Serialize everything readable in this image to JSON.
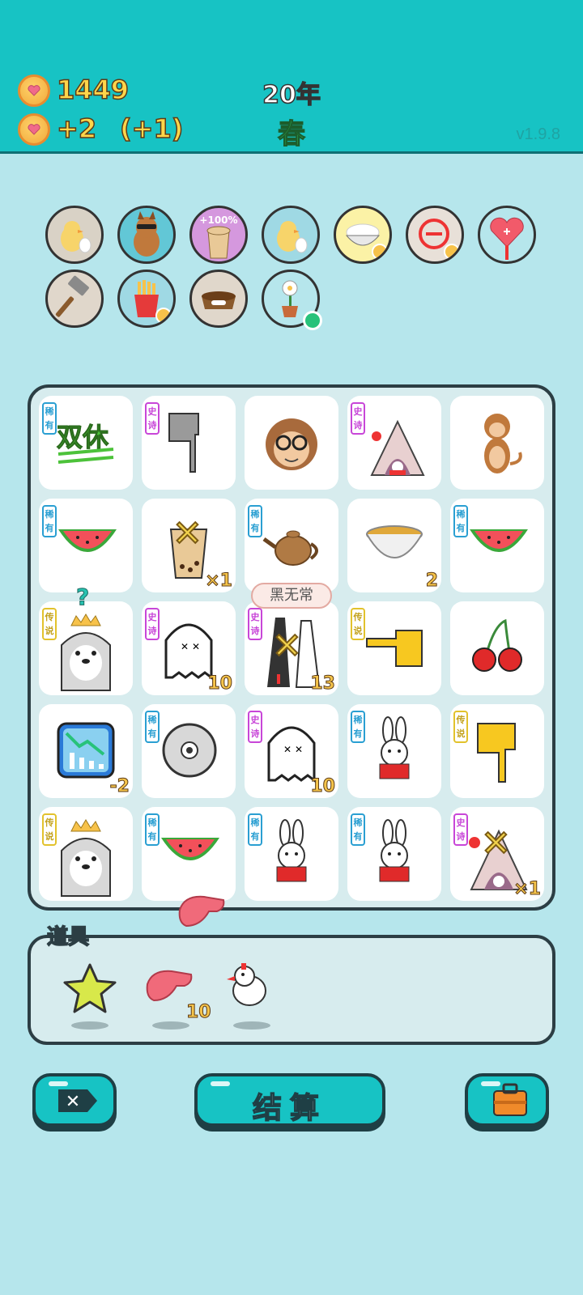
{
  "header": {
    "coins": "1449",
    "income": "+2",
    "bonus": "(+1)",
    "year": "20年",
    "season": "春",
    "version": "v1.9.8"
  },
  "buffs": {
    "items": [
      {
        "icon": "chick-egg-icon"
      },
      {
        "icon": "dog-sunglasses-icon"
      },
      {
        "icon": "bubble-tea-icon",
        "label": "+100%"
      },
      {
        "icon": "chick-egg-icon"
      },
      {
        "icon": "rice-bowl-icon"
      },
      {
        "icon": "minus-circle-icon"
      },
      {
        "icon": "heart-sign-icon"
      },
      {
        "icon": "hammer-icon"
      },
      {
        "icon": "fries-icon"
      },
      {
        "icon": "pet-food-icon"
      },
      {
        "icon": "flower-pot-icon"
      }
    ]
  },
  "board": {
    "rows": [
      [
        {
          "icon": "double-rest-icon",
          "tag": "稀有",
          "rarity": "rare",
          "text": "双休"
        },
        {
          "icon": "pointing-hand-gray-icon",
          "tag": "史诗",
          "rarity": "epic"
        },
        {
          "icon": "old-monkey-glasses-icon"
        },
        {
          "icon": "rabbit-tent-icon",
          "tag": "史诗",
          "rarity": "epic"
        },
        {
          "icon": "monkey-icon"
        }
      ],
      [
        {
          "icon": "watermelon-icon",
          "tag": "稀有",
          "rarity": "rare"
        },
        {
          "icon": "bubble-tea-crossed-icon",
          "count": "×1"
        },
        {
          "icon": "teapot-icon",
          "tag": "稀有",
          "rarity": "rare"
        },
        {
          "icon": "soup-bowl-icon",
          "count": "2"
        },
        {
          "icon": "watermelon-icon",
          "tag": "稀有",
          "rarity": "rare"
        }
      ],
      [
        {
          "icon": "husky-king-icon",
          "tag": "传说",
          "rarity": "legend",
          "mark": "?"
        },
        {
          "icon": "ghost-icon",
          "tag": "史诗",
          "rarity": "epic",
          "count": "10"
        },
        {
          "icon": "black-white-impermanence-icon",
          "tag": "史诗",
          "rarity": "epic",
          "count": "13"
        },
        {
          "icon": "pointing-hand-yellow-icon",
          "tag": "传说",
          "rarity": "legend"
        },
        {
          "icon": "cherry-icon"
        }
      ],
      [
        {
          "icon": "chart-down-icon",
          "count": "-2"
        },
        {
          "icon": "cd-disc-icon",
          "tag": "稀有",
          "rarity": "rare"
        },
        {
          "icon": "ghost-icon",
          "tag": "史诗",
          "rarity": "epic",
          "count": "10"
        },
        {
          "icon": "rabbit-icon",
          "tag": "稀有",
          "rarity": "rare"
        },
        {
          "icon": "pointing-hand-down-icon",
          "tag": "传说",
          "rarity": "legend"
        }
      ],
      [
        {
          "icon": "husky-king-icon",
          "tag": "传说",
          "rarity": "legend"
        },
        {
          "icon": "watermelon-icon",
          "tag": "稀有",
          "rarity": "rare"
        },
        {
          "icon": "rabbit-icon",
          "tag": "稀有",
          "rarity": "rare"
        },
        {
          "icon": "rabbit-icon",
          "tag": "稀有",
          "rarity": "rare"
        },
        {
          "icon": "rabbit-tent-crossed-icon",
          "tag": "史诗",
          "rarity": "epic",
          "count": "×1"
        }
      ]
    ],
    "tooltip": "黑无常"
  },
  "props": {
    "title": "道具",
    "items": [
      {
        "icon": "star-icon"
      },
      {
        "icon": "liver-icon",
        "count": "10"
      },
      {
        "icon": "white-bird-icon"
      }
    ]
  },
  "buttons": {
    "skip_icon": "close-tag-icon",
    "settle_label": "结算",
    "bag_icon": "briefcase-icon"
  }
}
